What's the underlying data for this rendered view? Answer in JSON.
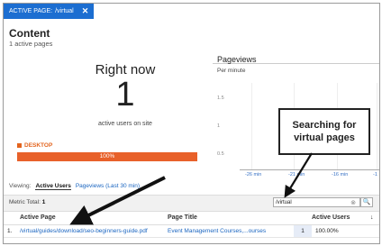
{
  "chip": {
    "label": "ACTIVE PAGE:",
    "value": "/virtual",
    "close": "✕"
  },
  "content": {
    "title": "Content",
    "subtitle": "1 active pages"
  },
  "rightnow": {
    "title": "Right now",
    "count": "1",
    "label": "active users on site"
  },
  "device": {
    "label": "DESKTOP",
    "percent": "100%",
    "fraction": 1.0
  },
  "viewing": {
    "label": "Viewing:",
    "active_tab": "Active Users",
    "other_tab": "Pageviews (Last 30 min)"
  },
  "pageviews": {
    "title": "Pageviews",
    "subtitle": "Per minute",
    "y_ticks": [
      "1.5",
      "1",
      "0.5"
    ],
    "x_ticks": [
      "-26 min",
      "-21 min",
      "-16 min",
      "-1"
    ]
  },
  "callout": {
    "line1": "Searching for",
    "line2": "virtual pages"
  },
  "metric": {
    "label": "Metric Total:",
    "value": "1"
  },
  "search": {
    "value": "/virtual",
    "clear": "⊗",
    "button": "🔍"
  },
  "table": {
    "headers": [
      "Active Page",
      "Page Title",
      "Active Users"
    ],
    "sort_icon": "↓",
    "rows": [
      {
        "index": "1.",
        "page": "/virtual/guides/download/seo-beginners-guide.pdf",
        "title": "Event Management Courses,...ourses",
        "users": "1",
        "percent": "100.00%"
      }
    ]
  }
}
